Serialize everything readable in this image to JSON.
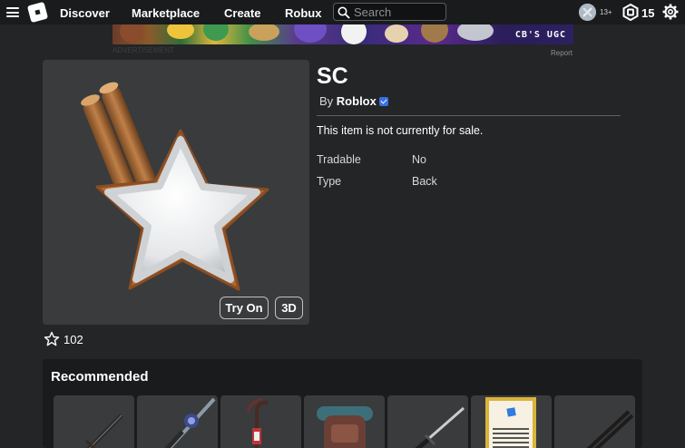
{
  "nav": {
    "links": [
      "Discover",
      "Marketplace",
      "Create",
      "Robux"
    ],
    "search_placeholder": "Search",
    "age_tag": "13+",
    "robux_balance": "15"
  },
  "ad": {
    "text": "CB'S UGC",
    "label": "ADVERTISEMENT",
    "report": "Report"
  },
  "item": {
    "name": "SC",
    "by_prefix": "By",
    "creator": "Roblox",
    "verified": true,
    "sale_status": "This item is not currently for sale.",
    "attributes": [
      {
        "label": "Tradable",
        "value": "No"
      },
      {
        "label": "Type",
        "value": "Back"
      }
    ],
    "try_on_label": "Try On",
    "three_d_label": "3D",
    "favorites": "102"
  },
  "recommended": {
    "title": "Recommended",
    "items": [
      {
        "icon": "dark-sword-icon"
      },
      {
        "icon": "crystal-sword-icon"
      },
      {
        "icon": "scythe-staff-icon"
      },
      {
        "icon": "backpack-icon"
      },
      {
        "icon": "katana-icon"
      },
      {
        "icon": "paper-note-icon"
      },
      {
        "icon": "black-sword-icon"
      }
    ]
  },
  "colors": {
    "background": "#232527",
    "topbar": "#191b1d",
    "card": "#393b3d",
    "verified_badge": "#3b6fe0"
  }
}
